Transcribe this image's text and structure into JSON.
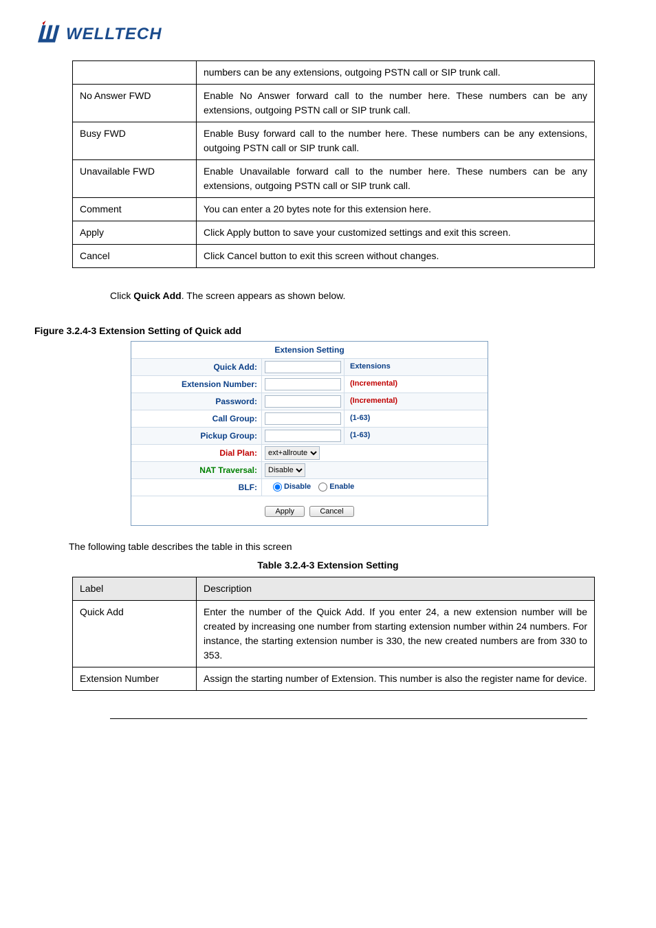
{
  "logo_text": "WELLTECH",
  "table1": {
    "rows": [
      {
        "label": "",
        "desc": "numbers can be any extensions, outgoing PSTN call or SIP trunk call."
      },
      {
        "label": "No Answer FWD",
        "desc": "Enable No Answer forward call to the number here. These numbers can be any extensions, outgoing PSTN call or SIP trunk call."
      },
      {
        "label": "Busy FWD",
        "desc": "Enable Busy forward call to the number here. These numbers can be any extensions, outgoing PSTN call or SIP trunk call."
      },
      {
        "label": "Unavailable FWD",
        "desc": "Enable Unavailable forward call to the number here. These numbers can be any extensions, outgoing PSTN call or SIP trunk call."
      },
      {
        "label": "Comment",
        "desc": "You can enter a 20 bytes note for this extension here."
      },
      {
        "label": "Apply",
        "desc": "Click Apply button to save your customized settings and exit this screen."
      },
      {
        "label": "Cancel",
        "desc": "Click Cancel button to exit this screen without changes."
      }
    ]
  },
  "quick_add_text_pre": "Click ",
  "quick_add_bold": "Quick Add",
  "quick_add_text_post": ". The screen appears as shown below.",
  "figure_caption": "Figure   3.2.4-3 Extension Setting of Quick add",
  "ext_setting": {
    "title": "Extension Setting",
    "rows": {
      "quick_add": {
        "label": "Quick Add:",
        "hint": "Extensions"
      },
      "ext_number": {
        "label": "Extension Number:",
        "hint": "(Incremental)"
      },
      "password": {
        "label": "Password:",
        "hint": "(Incremental)"
      },
      "call_group": {
        "label": "Call Group:",
        "hint": "(1-63)"
      },
      "pickup_group": {
        "label": "Pickup Group:",
        "hint": "(1-63)"
      },
      "dial_plan": {
        "label": "Dial Plan:",
        "value": "ext+allroute"
      },
      "nat": {
        "label": "NAT Traversal:",
        "value": "Disable"
      },
      "blf": {
        "label": "BLF:",
        "opt1": "Disable",
        "opt2": "Enable"
      }
    },
    "apply": "Apply",
    "cancel": "Cancel"
  },
  "following_text": "The following table describes the table in this screen",
  "table_caption": "Table 3.2.4-3 Extension Setting",
  "table2": {
    "header": {
      "label": "Label",
      "desc": "Description"
    },
    "rows": [
      {
        "label": "Quick Add",
        "desc": "Enter the number of the Quick Add. If you enter 24, a new extension number will be created by increasing one number from starting extension number within 24 numbers. For instance, the starting extension number is 330, the new created numbers are from 330 to 353."
      },
      {
        "label": "Extension Number",
        "desc": "Assign the starting number of Extension. This number is also the register name for device."
      }
    ]
  }
}
